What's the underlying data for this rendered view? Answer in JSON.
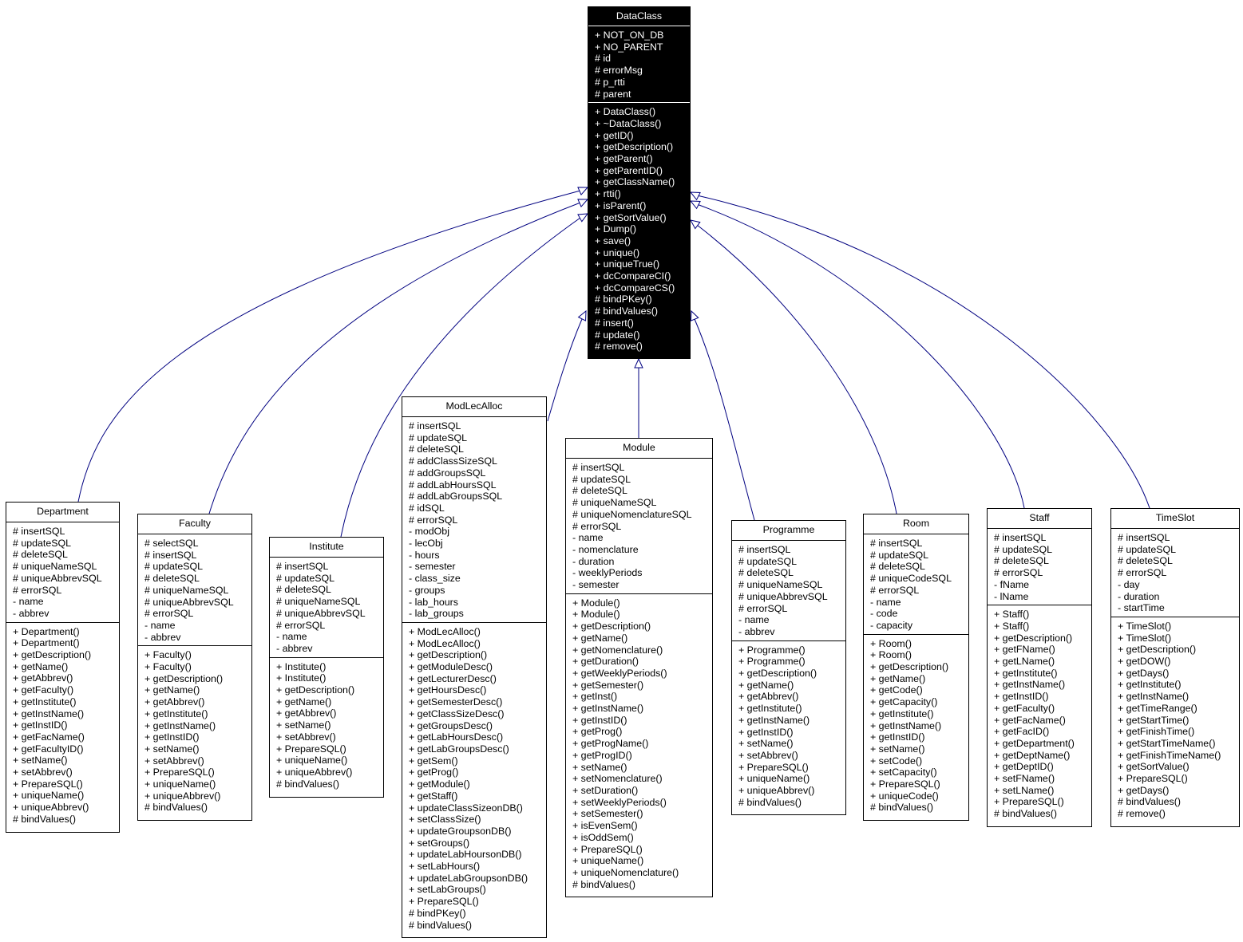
{
  "diagram": {
    "type": "uml-class-inheritance",
    "edge_color": "#000080",
    "root_fill": "#000000",
    "root": {
      "name": "DataClass",
      "attributes": [
        "+ NOT_ON_DB",
        "+ NO_PARENT",
        "# id",
        "# errorMsg",
        "# p_rtti",
        "# parent"
      ],
      "methods": [
        "+ DataClass()",
        "+ ~DataClass()",
        "+ getID()",
        "+ getDescription()",
        "+ getParent()",
        "+ getParentID()",
        "+ getClassName()",
        "+ rtti()",
        "+ isParent()",
        "+ getSortValue()",
        "+ Dump()",
        "+ save()",
        "+ unique()",
        "+ uniqueTrue()",
        "+ dcCompareCI()",
        "+ dcCompareCS()",
        "# bindPKey()",
        "# bindValues()",
        "# insert()",
        "# update()",
        "# remove()"
      ]
    },
    "children": [
      {
        "name": "Department",
        "attributes": [
          "# insertSQL",
          "# updateSQL",
          "# deleteSQL",
          "# uniqueNameSQL",
          "# uniqueAbbrevSQL",
          "# errorSQL",
          "- name",
          "- abbrev"
        ],
        "methods": [
          "+ Department()",
          "+ Department()",
          "+ getDescription()",
          "+ getName()",
          "+ getAbbrev()",
          "+ getFaculty()",
          "+ getInstitute()",
          "+ getInstName()",
          "+ getInstID()",
          "+ getFacName()",
          "+ getFacultyID()",
          "+ setName()",
          "+ setAbbrev()",
          "+ PrepareSQL()",
          "+ uniqueName()",
          "+ uniqueAbbrev()",
          "# bindValues()"
        ]
      },
      {
        "name": "Faculty",
        "attributes": [
          "# selectSQL",
          "# insertSQL",
          "# updateSQL",
          "# deleteSQL",
          "# uniqueNameSQL",
          "# uniqueAbbrevSQL",
          "# errorSQL",
          "- name",
          "- abbrev"
        ],
        "methods": [
          "+ Faculty()",
          "+ Faculty()",
          "+ getDescription()",
          "+ getName()",
          "+ getAbbrev()",
          "+ getInstitute()",
          "+ getInstName()",
          "+ getInstID()",
          "+ setName()",
          "+ setAbbrev()",
          "+ PrepareSQL()",
          "+ uniqueName()",
          "+ uniqueAbbrev()",
          "# bindValues()"
        ]
      },
      {
        "name": "Institute",
        "attributes": [
          "# insertSQL",
          "# updateSQL",
          "# deleteSQL",
          "# uniqueNameSQL",
          "# uniqueAbbrevSQL",
          "# errorSQL",
          "- name",
          "- abbrev"
        ],
        "methods": [
          "+ Institute()",
          "+ Institute()",
          "+ getDescription()",
          "+ getName()",
          "+ getAbbrev()",
          "+ setName()",
          "+ setAbbrev()",
          "+ PrepareSQL()",
          "+ uniqueName()",
          "+ uniqueAbbrev()",
          "# bindValues()"
        ]
      },
      {
        "name": "ModLecAlloc",
        "attributes": [
          "# insertSQL",
          "# updateSQL",
          "# deleteSQL",
          "# addClassSizeSQL",
          "# addGroupsSQL",
          "# addLabHoursSQL",
          "# addLabGroupsSQL",
          "# idSQL",
          "# errorSQL",
          "- modObj",
          "- lecObj",
          "- hours",
          "- semester",
          "- class_size",
          "- groups",
          "- lab_hours",
          "- lab_groups"
        ],
        "methods": [
          "+ ModLecAlloc()",
          "+ ModLecAlloc()",
          "+ getDescription()",
          "+ getModuleDesc()",
          "+ getLecturerDesc()",
          "+ getHoursDesc()",
          "+ getSemesterDesc()",
          "+ getClassSizeDesc()",
          "+ getGroupsDesc()",
          "+ getLabHoursDesc()",
          "+ getLabGroupsDesc()",
          "+ getSem()",
          "+ getProg()",
          "+ getModule()",
          "+ getStaff()",
          "+ updateClassSizeonDB()",
          "+ setClassSize()",
          "+ updateGroupsonDB()",
          "+ setGroups()",
          "+ updateLabHoursonDB()",
          "+ setLabHours()",
          "+ updateLabGroupsonDB()",
          "+ setLabGroups()",
          "+ PrepareSQL()",
          "# bindPKey()",
          "# bindValues()"
        ]
      },
      {
        "name": "Module",
        "attributes": [
          "# insertSQL",
          "# updateSQL",
          "# deleteSQL",
          "# uniqueNameSQL",
          "# uniqueNomenclatureSQL",
          "# errorSQL",
          "- name",
          "- nomenclature",
          "- duration",
          "- weeklyPeriods",
          "- semester"
        ],
        "methods": [
          "+ Module()",
          "+ Module()",
          "+ getDescription()",
          "+ getName()",
          "+ getNomenclature()",
          "+ getDuration()",
          "+ getWeeklyPeriods()",
          "+ getSemester()",
          "+ getInst()",
          "+ getInstName()",
          "+ getInstID()",
          "+ getProg()",
          "+ getProgName()",
          "+ getProgID()",
          "+ setName()",
          "+ setNomenclature()",
          "+ setDuration()",
          "+ setWeeklyPeriods()",
          "+ setSemester()",
          "+ isEvenSem()",
          "+ isOddSem()",
          "+ PrepareSQL()",
          "+ uniqueName()",
          "+ uniqueNomenclature()",
          "# bindValues()"
        ]
      },
      {
        "name": "Programme",
        "attributes": [
          "# insertSQL",
          "# updateSQL",
          "# deleteSQL",
          "# uniqueNameSQL",
          "# uniqueAbbrevSQL",
          "# errorSQL",
          "- name",
          "- abbrev"
        ],
        "methods": [
          "+ Programme()",
          "+ Programme()",
          "+ getDescription()",
          "+ getName()",
          "+ getAbbrev()",
          "+ getInstitute()",
          "+ getInstName()",
          "+ getInstID()",
          "+ setName()",
          "+ setAbbrev()",
          "+ PrepareSQL()",
          "+ uniqueName()",
          "+ uniqueAbbrev()",
          "# bindValues()"
        ]
      },
      {
        "name": "Room",
        "attributes": [
          "# insertSQL",
          "# updateSQL",
          "# deleteSQL",
          "# uniqueCodeSQL",
          "# errorSQL",
          "- name",
          "- code",
          "- capacity"
        ],
        "methods": [
          "+ Room()",
          "+ Room()",
          "+ getDescription()",
          "+ getName()",
          "+ getCode()",
          "+ getCapacity()",
          "+ getInstitute()",
          "+ getInstName()",
          "+ getInstID()",
          "+ setName()",
          "+ setCode()",
          "+ setCapacity()",
          "+ PrepareSQL()",
          "+ uniqueCode()",
          "# bindValues()"
        ]
      },
      {
        "name": "Staff",
        "attributes": [
          "# insertSQL",
          "# updateSQL",
          "# deleteSQL",
          "# errorSQL",
          "- fName",
          "- lName"
        ],
        "methods": [
          "+ Staff()",
          "+ Staff()",
          "+ getDescription()",
          "+ getFName()",
          "+ getLName()",
          "+ getInstitute()",
          "+ getInstName()",
          "+ getInstID()",
          "+ getFaculty()",
          "+ getFacName()",
          "+ getFacID()",
          "+ getDepartment()",
          "+ getDeptName()",
          "+ getDeptID()",
          "+ setFName()",
          "+ setLName()",
          "+ PrepareSQL()",
          "# bindValues()"
        ]
      },
      {
        "name": "TimeSlot",
        "attributes": [
          "# insertSQL",
          "# updateSQL",
          "# deleteSQL",
          "# errorSQL",
          "- day",
          "- duration",
          "- startTime"
        ],
        "methods": [
          "+ TimeSlot()",
          "+ TimeSlot()",
          "+ getDescription()",
          "+ getDOW()",
          "+ getDays()",
          "+ getInstitute()",
          "+ getInstName()",
          "+ getTimeRange()",
          "+ getStartTime()",
          "+ getFinishTime()",
          "+ getStartTimeName()",
          "+ getFinishTimeName()",
          "+ getSortValue()",
          "+ PrepareSQL()",
          "+ getDays()",
          "# bindValues()",
          "# remove()"
        ]
      }
    ]
  }
}
